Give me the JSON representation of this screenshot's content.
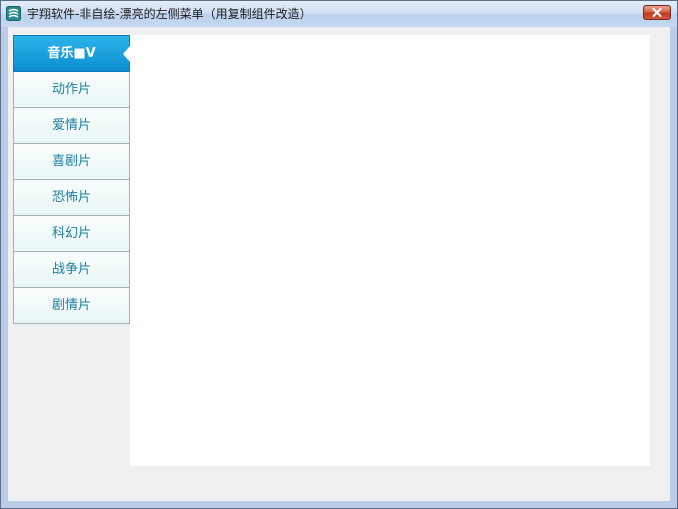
{
  "window": {
    "title": "宇翔软件-非自绘-漂亮的左侧菜单（用复制组件改造）",
    "icon": "app-logo-icon",
    "close_icon": "close-icon"
  },
  "menu": {
    "items": [
      {
        "label": "音乐■V",
        "active": true
      },
      {
        "label": "动作片",
        "active": false
      },
      {
        "label": "爱情片",
        "active": false
      },
      {
        "label": "喜剧片",
        "active": false
      },
      {
        "label": "恐怖片",
        "active": false
      },
      {
        "label": "科幻片",
        "active": false
      },
      {
        "label": "战争片",
        "active": false
      },
      {
        "label": "剧情片",
        "active": false
      }
    ]
  },
  "colors": {
    "menu_active_top": "#2db3ea",
    "menu_active_bottom": "#0b8ed0",
    "menu_text": "#1d7fa4",
    "menu_border": "#9db3b8",
    "content_bg": "#ffffff",
    "client_bg": "#f0f0f0"
  }
}
